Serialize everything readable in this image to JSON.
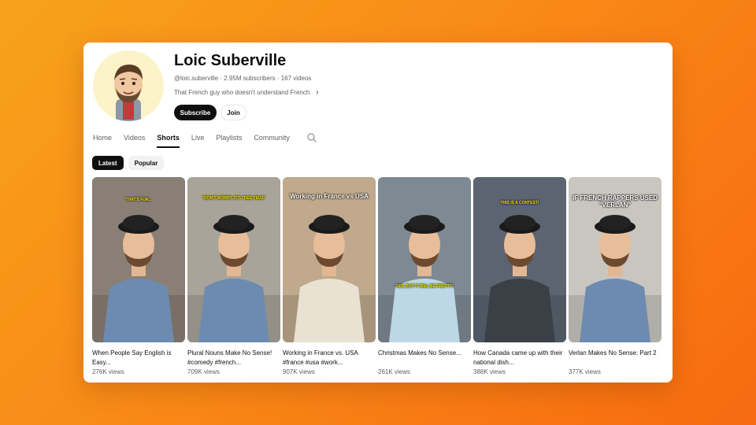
{
  "channel": {
    "name": "Loic Suberville",
    "meta": "@loic.suberville · 2.95M subscribers · 167 videos",
    "description": "That French guy who doesn't understand French",
    "subscribe_label": "Subscribe",
    "join_label": "Join"
  },
  "tabs": [
    {
      "label": "Home"
    },
    {
      "label": "Videos"
    },
    {
      "label": "Shorts",
      "active": true
    },
    {
      "label": "Live"
    },
    {
      "label": "Playlists"
    },
    {
      "label": "Community"
    }
  ],
  "chips": [
    {
      "label": "Latest",
      "active": true
    },
    {
      "label": "Popular"
    }
  ],
  "shorts": [
    {
      "title": "When People Say English is Easy...",
      "views": "276K views",
      "caption": "THAT'S FUN...",
      "bg": "#8a7f74"
    },
    {
      "title": "Plural Nouns Make No Sense! #comedy #french...",
      "views": "709K views",
      "caption": "\"DON'T WORRY, IT'S \"DES YEUX\"",
      "bg": "#a9a49a"
    },
    {
      "title": "Working in France vs. USA #france #usa #work...",
      "views": "907K views",
      "caption": "Working in France vs USA",
      "bg": "#c0a98c"
    },
    {
      "title": "Christmas Makes No Sense...",
      "views": "261K views",
      "caption": "YES, BUT IT WILL BE PRETTY!",
      "bg": "#7e8a93"
    },
    {
      "title": "How Canada came up with their national dish...",
      "views": "388K views",
      "caption": "THIS IS A CONTEST!",
      "bg": "#5b6470"
    },
    {
      "title": "Verlan Makes No Sense: Part 2",
      "views": "377K views",
      "caption": "IF FRENCH RAPPERS USED \"VERLAN\"",
      "bg": "#c9c6c0"
    }
  ],
  "colors": {
    "background_start": "#f7a21b",
    "background_end": "#f76a10",
    "primary_text": "#0f0f0f",
    "secondary_text": "#606060",
    "caption_yellow": "#ffe600"
  }
}
